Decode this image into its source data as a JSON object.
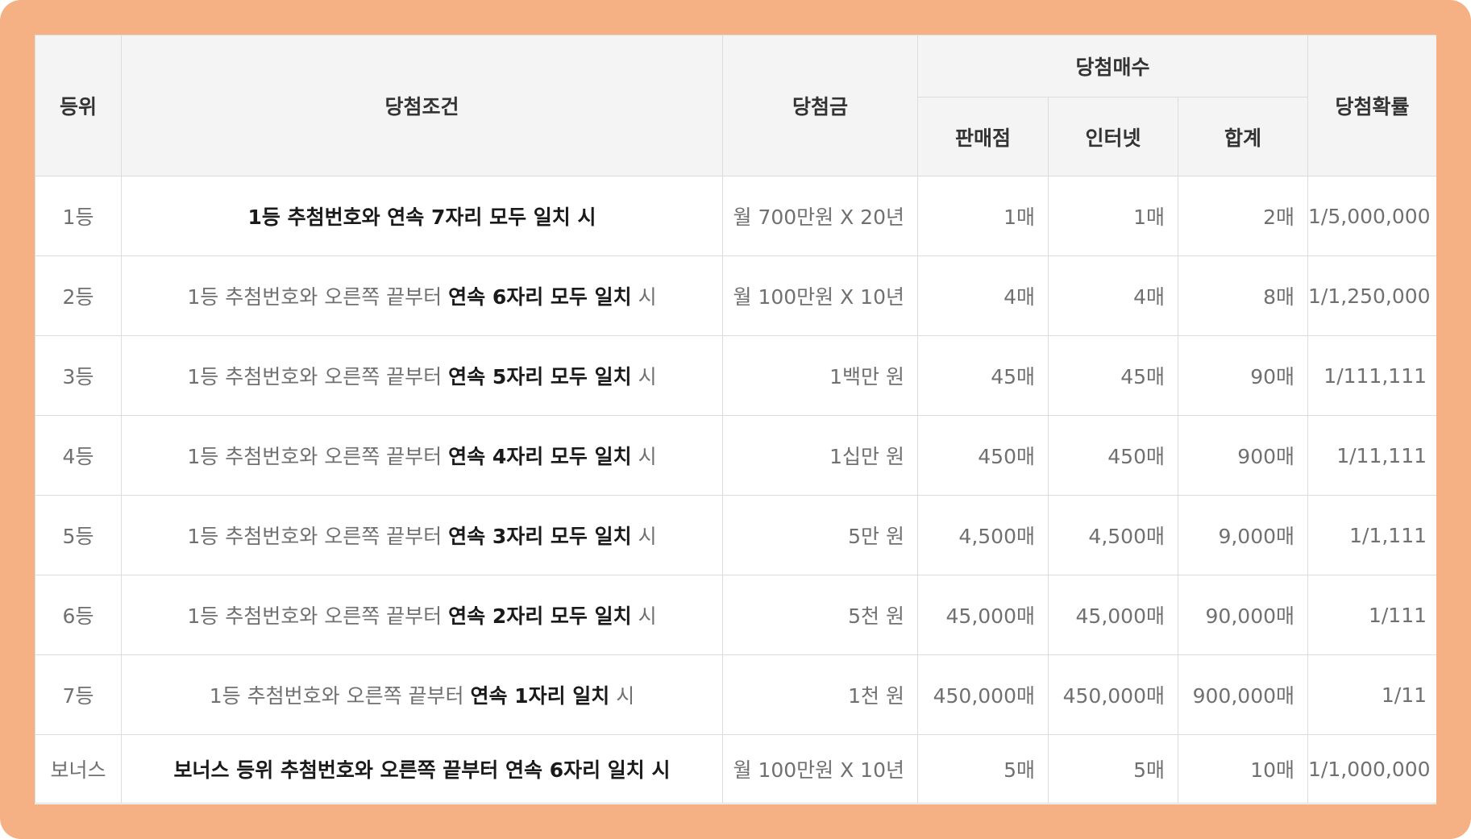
{
  "table": {
    "headers": {
      "rank": "등위",
      "condition": "당첨조건",
      "prize": "당첨금",
      "winners": "당첨매수",
      "store": "판매점",
      "internet": "인터넷",
      "total": "합계",
      "probability": "당첨확률"
    },
    "rows": [
      {
        "rank": "1등",
        "cond_pre": "",
        "cond_bold": "1등 추첨번호와 연속 7자리 모두 일치 시",
        "cond_post": "",
        "prize": "월 700만원 X 20년",
        "store": "1매",
        "internet": "1매",
        "total": "2매",
        "probability": "1/5,000,000"
      },
      {
        "rank": "2등",
        "cond_pre": "1등 추첨번호와 오른쪽 끝부터 ",
        "cond_bold": "연속 6자리 모두 일치",
        "cond_post": " 시",
        "prize": "월 100만원 X 10년",
        "store": "4매",
        "internet": "4매",
        "total": "8매",
        "probability": "1/1,250,000"
      },
      {
        "rank": "3등",
        "cond_pre": "1등 추첨번호와 오른쪽 끝부터 ",
        "cond_bold": "연속 5자리 모두 일치",
        "cond_post": " 시",
        "prize": "1백만 원",
        "store": "45매",
        "internet": "45매",
        "total": "90매",
        "probability": "1/111,111"
      },
      {
        "rank": "4등",
        "cond_pre": "1등 추첨번호와 오른쪽 끝부터 ",
        "cond_bold": "연속 4자리 모두 일치",
        "cond_post": " 시",
        "prize": "1십만 원",
        "store": "450매",
        "internet": "450매",
        "total": "900매",
        "probability": "1/11,111"
      },
      {
        "rank": "5등",
        "cond_pre": "1등 추첨번호와 오른쪽 끝부터 ",
        "cond_bold": "연속 3자리 모두 일치",
        "cond_post": " 시",
        "prize": "5만 원",
        "store": "4,500매",
        "internet": "4,500매",
        "total": "9,000매",
        "probability": "1/1,111"
      },
      {
        "rank": "6등",
        "cond_pre": "1등 추첨번호와 오른쪽 끝부터 ",
        "cond_bold": "연속 2자리 모두 일치",
        "cond_post": " 시",
        "prize": "5천 원",
        "store": "45,000매",
        "internet": "45,000매",
        "total": "90,000매",
        "probability": "1/111"
      },
      {
        "rank": "7등",
        "cond_pre": "1등 추첨번호와 오른쪽 끝부터 ",
        "cond_bold": "연속 1자리 일치",
        "cond_post": " 시",
        "prize": "1천 원",
        "store": "450,000매",
        "internet": "450,000매",
        "total": "900,000매",
        "probability": "1/11"
      },
      {
        "rank": "보너스",
        "cond_pre": "",
        "cond_bold": "보너스 등위 추첨번호와 오른쪽 끝부터 연속 6자리 일치 시",
        "cond_post": "",
        "prize": "월 100만원 X 10년",
        "store": "5매",
        "internet": "5매",
        "total": "10매",
        "probability": "1/1,000,000"
      }
    ]
  },
  "colors": {
    "frame": "#f5b083",
    "header_bg": "#f4f4f4",
    "border": "#dcdcdc"
  }
}
